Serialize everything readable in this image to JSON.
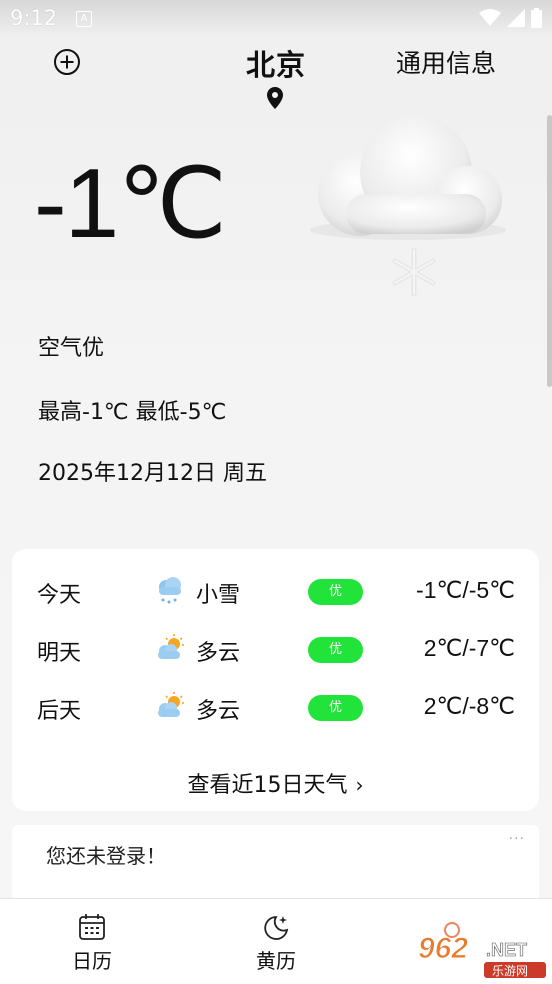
{
  "status_bar": {
    "time": "9:12",
    "notification_icon": "A"
  },
  "header": {
    "city": "北京",
    "info_link": "通用信息"
  },
  "current": {
    "temperature": "-1℃",
    "air_quality": "空气优",
    "high_low": "最高-1℃ 最低-5℃",
    "date": "2025年12月12日 周五",
    "icon": "snow-cloud-icon"
  },
  "forecast": {
    "rows": [
      {
        "day": "今天",
        "condition": "小雪",
        "icon": "light-snow-icon",
        "aq": "优",
        "range": "-1℃/-5℃"
      },
      {
        "day": "明天",
        "condition": "多云",
        "icon": "partly-cloudy-icon",
        "aq": "优",
        "range": "2℃/-7℃"
      },
      {
        "day": "后天",
        "condition": "多云",
        "icon": "partly-cloudy-icon",
        "aq": "优",
        "range": "2℃/-8℃"
      }
    ],
    "more_label": "查看近15日天气"
  },
  "login": {
    "text": "您还未登录！",
    "dots": "···"
  },
  "tabs": [
    {
      "label": "日历",
      "icon": "calendar-icon"
    },
    {
      "label": "黄历",
      "icon": "moon-star-icon"
    }
  ],
  "watermark": {
    "brand": "962",
    "net": ".NET",
    "sub": "乐游网"
  },
  "colors": {
    "aq_badge": "#22e33a",
    "background": "#f2f2f2"
  }
}
